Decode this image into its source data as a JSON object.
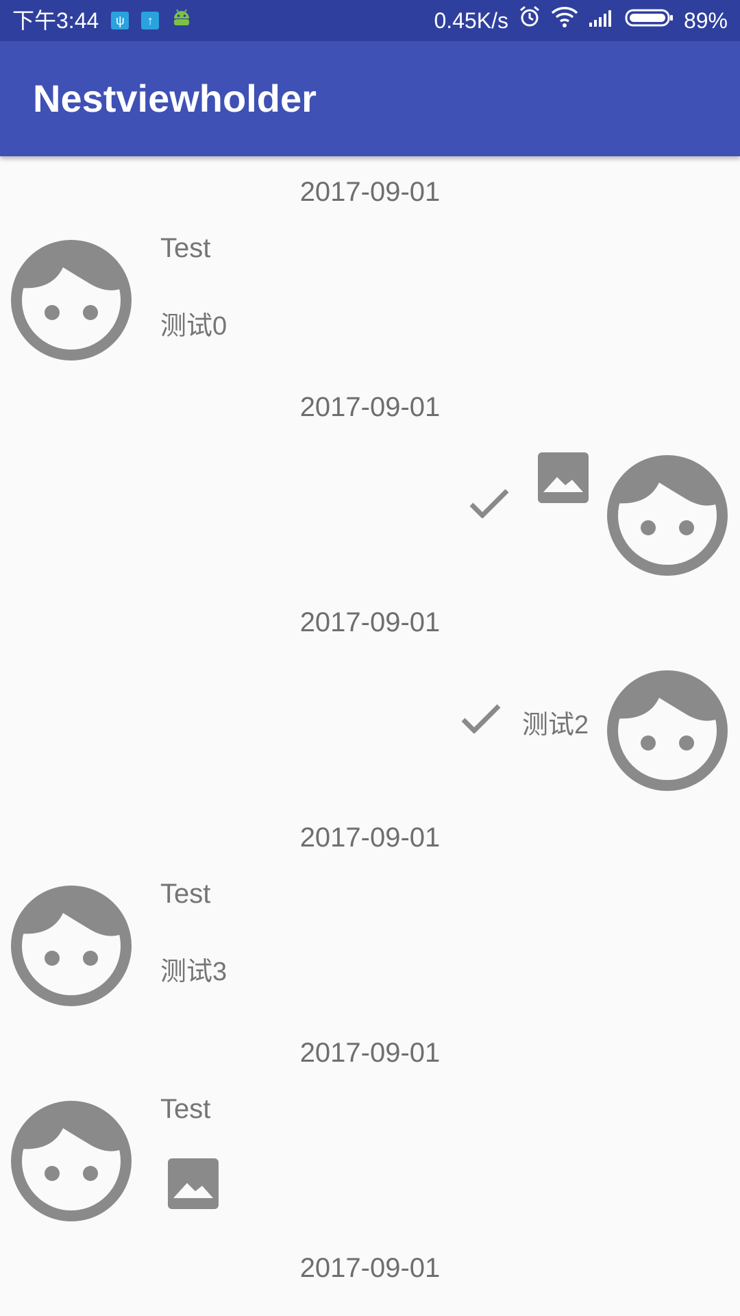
{
  "status_bar": {
    "time": "下午3:44",
    "net_speed": "0.45K/s",
    "battery": "89%",
    "icons": [
      "usb-icon",
      "upload-icon",
      "android-icon",
      "alarm-icon",
      "wifi-icon",
      "signal-icon",
      "battery-icon"
    ]
  },
  "app_bar": {
    "title": "Nestviewholder"
  },
  "colors": {
    "status_bar": "#2f3f9e",
    "app_bar": "#3f51b5",
    "background": "#fafafa",
    "icon_gray": "#8a8a8a",
    "text_gray": "#757575"
  },
  "messages": [
    {
      "date": "2017-09-01",
      "side": "left",
      "name": "Test",
      "text": "测试0",
      "type": "text"
    },
    {
      "date": "2017-09-01",
      "side": "right",
      "type": "image",
      "status": "sent"
    },
    {
      "date": "2017-09-01",
      "side": "right",
      "text": "测试2",
      "type": "text",
      "status": "sent"
    },
    {
      "date": "2017-09-01",
      "side": "left",
      "name": "Test",
      "text": "测试3",
      "type": "text"
    },
    {
      "date": "2017-09-01",
      "side": "left",
      "name": "Test",
      "type": "image"
    },
    {
      "date": "2017-09-01"
    }
  ]
}
